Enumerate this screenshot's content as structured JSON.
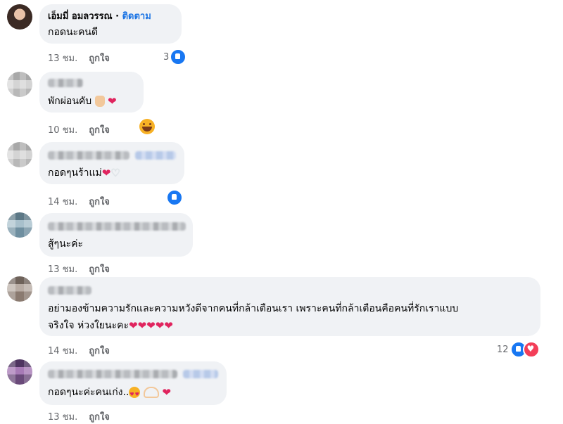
{
  "comments": [
    {
      "author": "เอ็มมี่ อมลวรรณ",
      "follow": "ติดตาม",
      "text": "กอดนะคนดี",
      "time": "13 ชม.",
      "like": "ถูกใจ",
      "reaction_count": "3",
      "reaction": "like-icon"
    },
    {
      "author": "",
      "text": "พักผ่อนคับ",
      "time": "10 ชม.",
      "like": "ถูกใจ",
      "reaction": "haha-icon"
    },
    {
      "author": "",
      "text": "กอดๆนร้าแม่",
      "time": "14 ชม.",
      "like": "ถูกใจ",
      "reaction": "like-icon"
    },
    {
      "author": "",
      "text": "สู้ๆนะค่ะ",
      "time": "13 ชม.",
      "like": "ถูกใจ"
    },
    {
      "author": "",
      "text_line1": "อย่ามองข้ามความรักและความหวังดีจากคนที่กล้าเตือนเรา เพราะคนที่กล้าเตือนคือคนที่รักเราแบบ",
      "text_line2": "จริงใจ ห่วงใยนะคะ",
      "time": "14 ชม.",
      "like": "ถูกใจ",
      "reaction_count": "12",
      "reaction": "like-love-icons"
    },
    {
      "author": "",
      "text": "กอดๆนะค่ะคนเก่ง..",
      "time": "13 ชม.",
      "like": "ถูกใจ"
    }
  ],
  "colors": {
    "bubble": "#f0f2f5",
    "link": "#1b74e4",
    "meta": "#65676b",
    "like_blue": "#1877f2",
    "love_red": "#f33e58"
  }
}
